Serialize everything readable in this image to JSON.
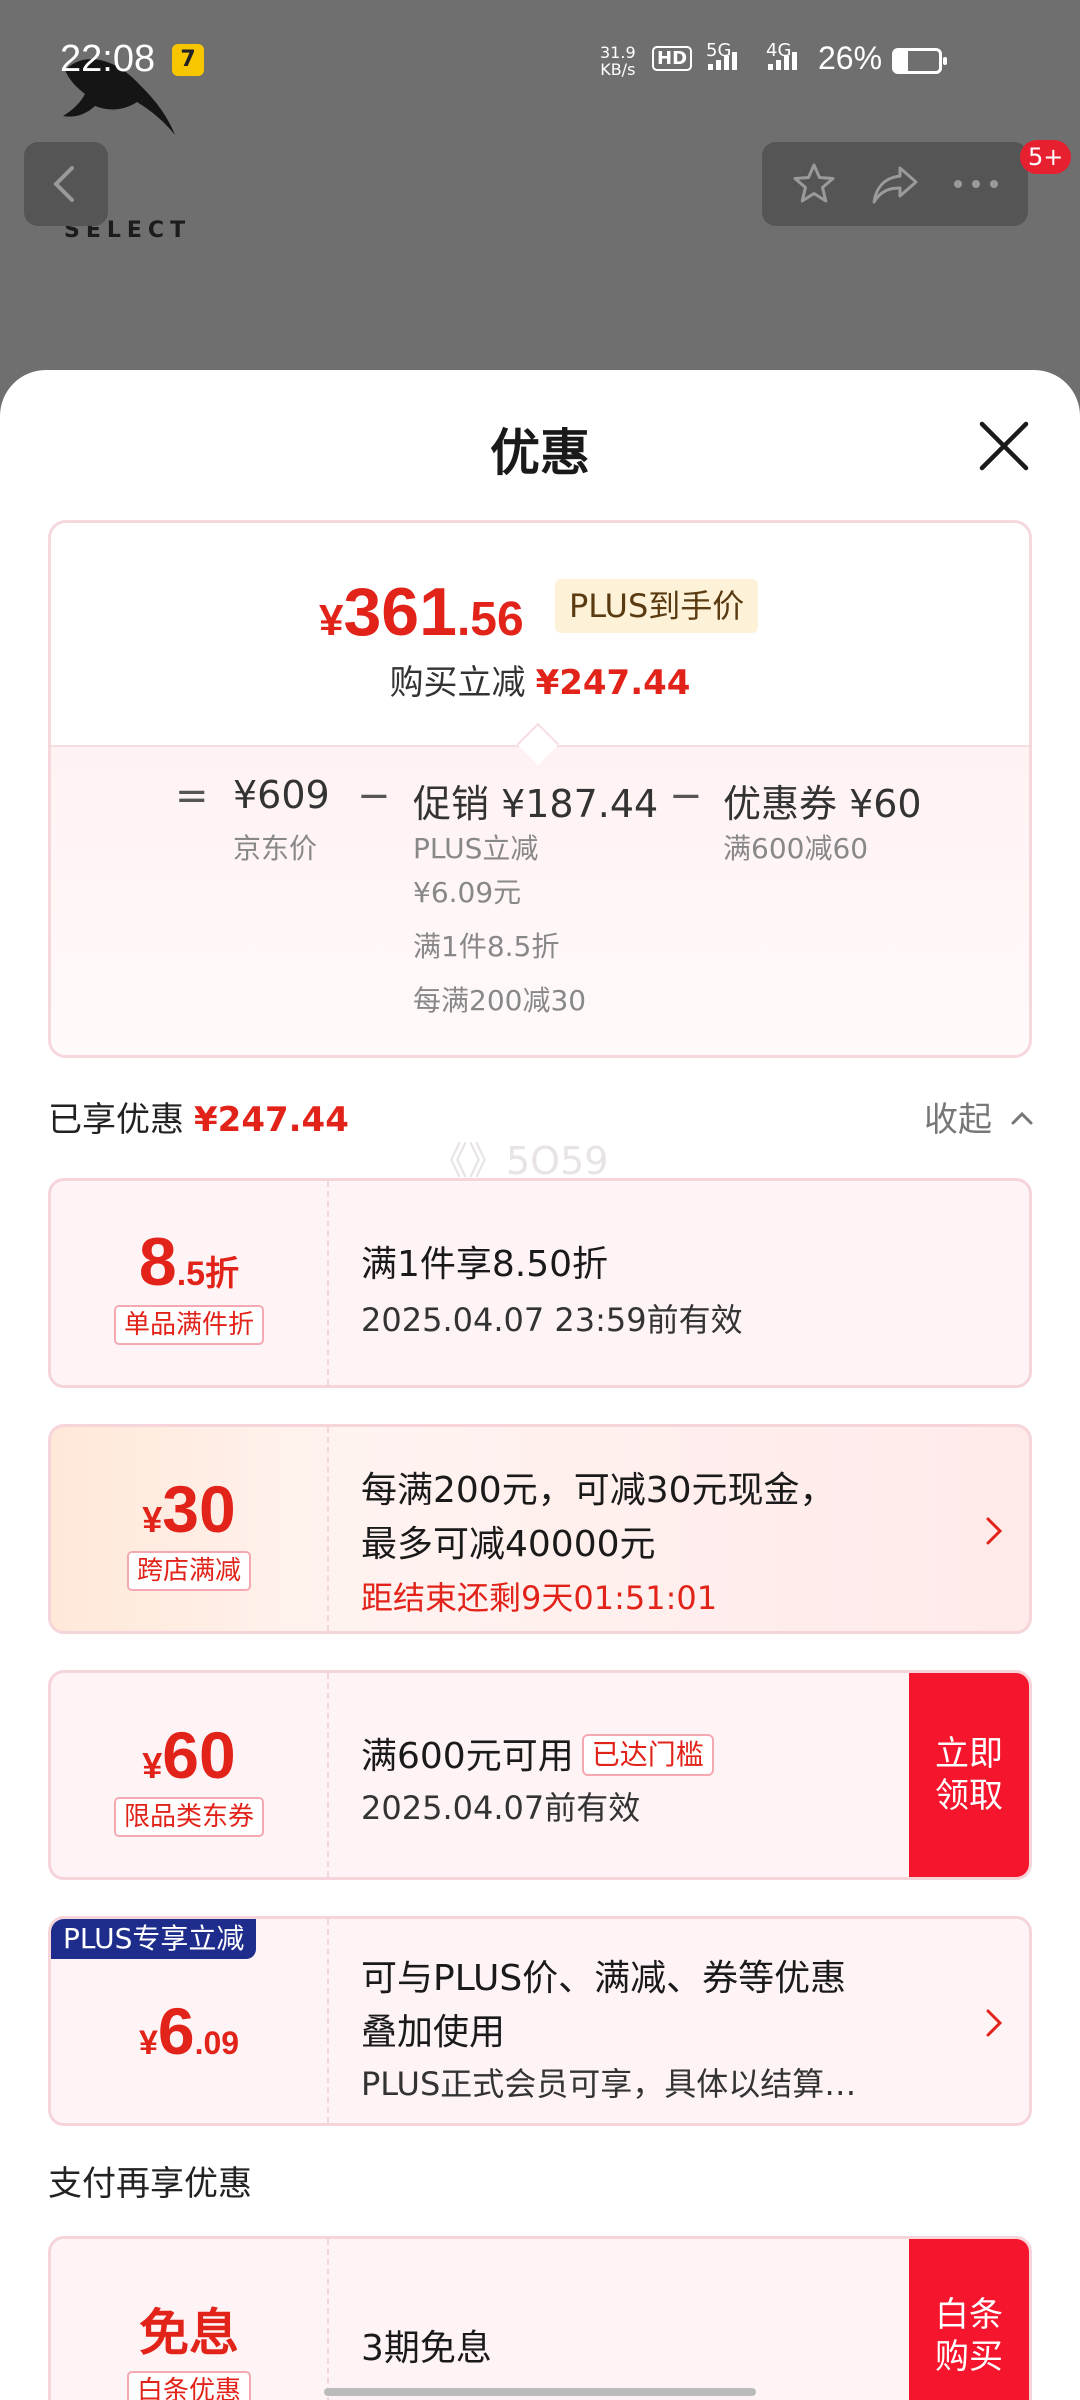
{
  "status_bar": {
    "time": "22:08",
    "app_badge": "7",
    "net_speed_value": "31.9",
    "net_speed_unit": "KB/s",
    "hd": "HD",
    "sig1": "5G",
    "sig2": "4G",
    "battery": "26%"
  },
  "background": {
    "brand_text": "SELECT",
    "notification_badge": "5+"
  },
  "sheet": {
    "title": "优惠"
  },
  "price_card": {
    "currency": "¥",
    "price_int": "361",
    "price_dec": ".56",
    "plus_tag": "PLUS到手价",
    "reduce_label": "购买立减",
    "reduce_amount": "¥247.44",
    "eq": "=",
    "minus": "−",
    "jd_price": "¥609",
    "jd_label": "京东价",
    "promo_main": "促销 ¥187.44",
    "promo_sub1": "PLUS立减",
    "promo_sub2": "¥6.09元",
    "promo_sub3": "满1件8.5折",
    "promo_sub4": "每满200减30",
    "coupon_main": "优惠券 ¥60",
    "coupon_sub": "满600减60"
  },
  "enjoyed": {
    "label": "已享优惠",
    "amount": "¥247.44",
    "collapse": "收起",
    "watermark": "《》5O59"
  },
  "coupons": [
    {
      "big_int": "8",
      "big_suffix": ".5折",
      "tag": "单品满件折",
      "title": "满1件享8.50折",
      "sub": "2025.04.07 23:59前有效"
    },
    {
      "currency": "¥",
      "big_int": "30",
      "tag": "跨店满减",
      "title1": "每满200元，可减30元现金，",
      "title2": "最多可减40000元",
      "countdown": "距结束还剩9天01:51:01"
    },
    {
      "currency": "¥",
      "big_int": "60",
      "tag": "限品类东券",
      "title": "满600元可用",
      "reached": "已达门槛",
      "sub": "2025.04.07前有效",
      "button": "立即领取"
    },
    {
      "corner": "PLUS专享立减",
      "currency": "¥",
      "big_int": "6",
      "big_dec": ".09",
      "title1": "可与PLUS价、满减、券等优惠",
      "title2": "叠加使用",
      "sub": "PLUS正式会员可享，具体以结算…"
    }
  ],
  "pay": {
    "title": "支付再享优惠",
    "big": "免息",
    "tag": "白条优惠",
    "title_text": "3期免息",
    "button": "白条购买"
  }
}
